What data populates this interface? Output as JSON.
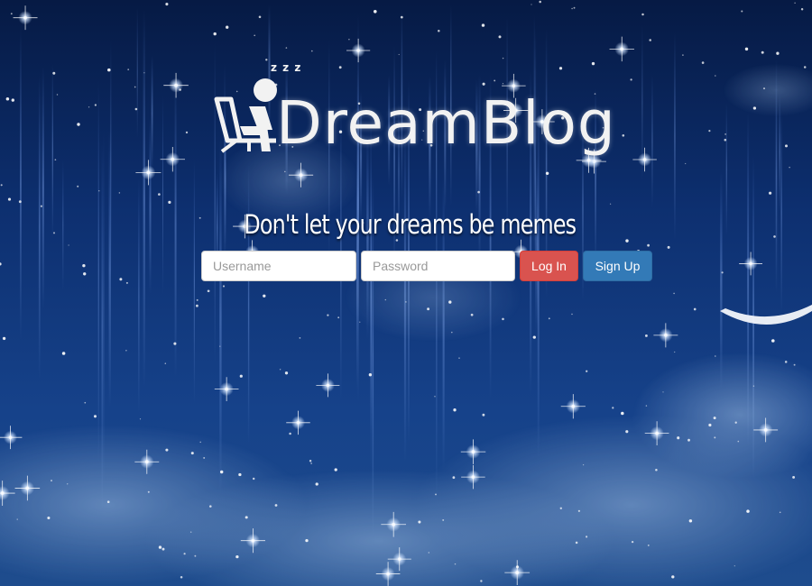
{
  "brand": {
    "name": "DreamBlog",
    "zzz_mark": "z z z"
  },
  "tagline": "Don't let your dreams be memes",
  "login_form": {
    "username_placeholder": "Username",
    "password_placeholder": "Password",
    "login_label": "Log In",
    "signup_label": "Sign Up"
  },
  "colors": {
    "login_button": "#d9534f",
    "signup_button": "#337ab7",
    "sky_top": "#061a44",
    "sky_bottom": "#1e4c8d"
  }
}
